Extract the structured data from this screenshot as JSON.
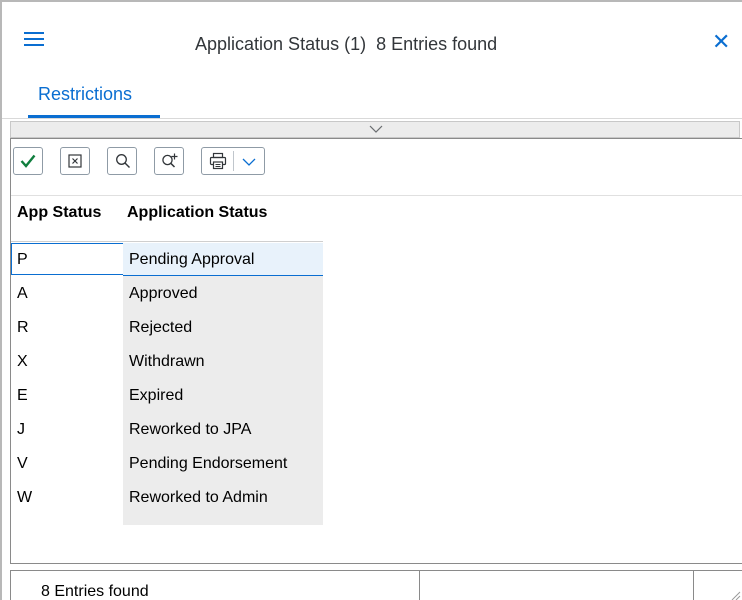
{
  "dialog": {
    "title": "Application Status (1)",
    "entries_found": "8 Entries found",
    "close_glyph": "✕"
  },
  "tabs": [
    {
      "label": "Restrictions",
      "active": true
    }
  ],
  "toolbar": {
    "buttons": [
      {
        "name": "accept",
        "icon": "checkmark-icon"
      },
      {
        "name": "cancel",
        "icon": "close-box-icon"
      },
      {
        "name": "search",
        "icon": "search-icon"
      },
      {
        "name": "search-more",
        "icon": "search-plus-icon"
      },
      {
        "name": "print",
        "icon": "print-icon",
        "has_dropdown": true
      }
    ]
  },
  "table": {
    "columns": [
      "App Status",
      "Application Status"
    ],
    "rows": [
      {
        "code": "P",
        "status": "Pending Approval",
        "selected": true
      },
      {
        "code": "A",
        "status": "Approved"
      },
      {
        "code": "R",
        "status": "Rejected"
      },
      {
        "code": "X",
        "status": "Withdrawn"
      },
      {
        "code": "E",
        "status": "Expired"
      },
      {
        "code": "J",
        "status": "Reworked to JPA"
      },
      {
        "code": "V",
        "status": "Pending Endorsement"
      },
      {
        "code": "W",
        "status": "Reworked to Admin"
      }
    ]
  },
  "status_bar": {
    "text": "8 Entries found"
  },
  "colors": {
    "accent": "#0a6ed1",
    "accept_green": "#107e3e",
    "column_bg": "#ececec"
  }
}
